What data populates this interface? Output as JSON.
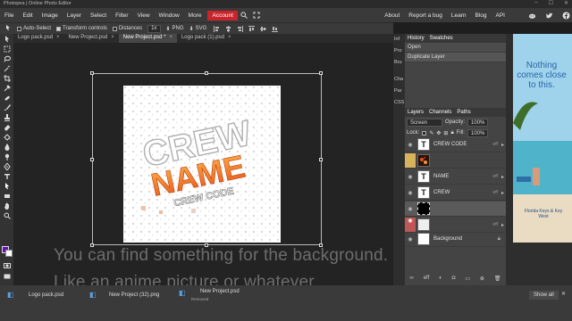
{
  "window": {
    "title": "Photopea | Online Photo Editor"
  },
  "menu": {
    "items": [
      "File",
      "Edit",
      "Image",
      "Layer",
      "Select",
      "Filter",
      "View",
      "Window",
      "More"
    ],
    "account": "Account",
    "right": [
      "About",
      "Report a bug",
      "Learn",
      "Blog",
      "API"
    ]
  },
  "options": {
    "auto_select": "Auto-Select",
    "transform_controls": "Transform controls",
    "distances": "Distances",
    "zoom": "1x",
    "png": "PNG",
    "svg": "SVG"
  },
  "tabs": [
    {
      "label": "Logo pack.psd",
      "close": "×"
    },
    {
      "label": "New Project.psd",
      "close": "×"
    },
    {
      "label": "New Project.psd *",
      "close": "×"
    },
    {
      "label": "Logo pack (1).psd",
      "close": "×"
    }
  ],
  "artwork": {
    "line1": "CREW",
    "line2": "NAME",
    "line3": "CREW CODE"
  },
  "caption": {
    "line1": "You can find something for the background.",
    "line2": "Like an anime picture or whatever"
  },
  "strip": [
    "Inf",
    "Pro",
    "Bru",
    "Cha",
    "Par",
    "CSS"
  ],
  "history": {
    "tabs": [
      "History",
      "Swatches"
    ],
    "items": [
      "Open",
      "Duplicate Layer"
    ]
  },
  "layers": {
    "tabs": [
      "Layers",
      "Channels",
      "Paths"
    ],
    "blend_mode": "Screen",
    "opacity_label": "Opacity:",
    "opacity": "100%",
    "lock_label": "Lock:",
    "fill_label": "Fill:",
    "fill": "100%",
    "fx_label": "eff",
    "rows": [
      {
        "name": "CREW CODE",
        "kind": "text"
      },
      {
        "name": "",
        "kind": "image"
      },
      {
        "name": "NAME",
        "kind": "text"
      },
      {
        "name": "CREW",
        "kind": "text"
      },
      {
        "name": "",
        "kind": "black"
      },
      {
        "name": "",
        "kind": "white"
      },
      {
        "name": "Background",
        "kind": "white"
      }
    ]
  },
  "ad": {
    "headline": "Nothing comes close to this.",
    "brand": "Florida Keys & Key West"
  },
  "bottom": {
    "tabs": [
      {
        "label": "Logo pack.psd"
      },
      {
        "label": "New Project (32).png"
      },
      {
        "label": "New Project.psd",
        "sub": "Removed"
      }
    ],
    "show_all": "Show all"
  },
  "colors": {
    "accent_red": "#c9242b",
    "foreground_swatch": "#6a0fb6",
    "orange": "#f07d1a"
  }
}
